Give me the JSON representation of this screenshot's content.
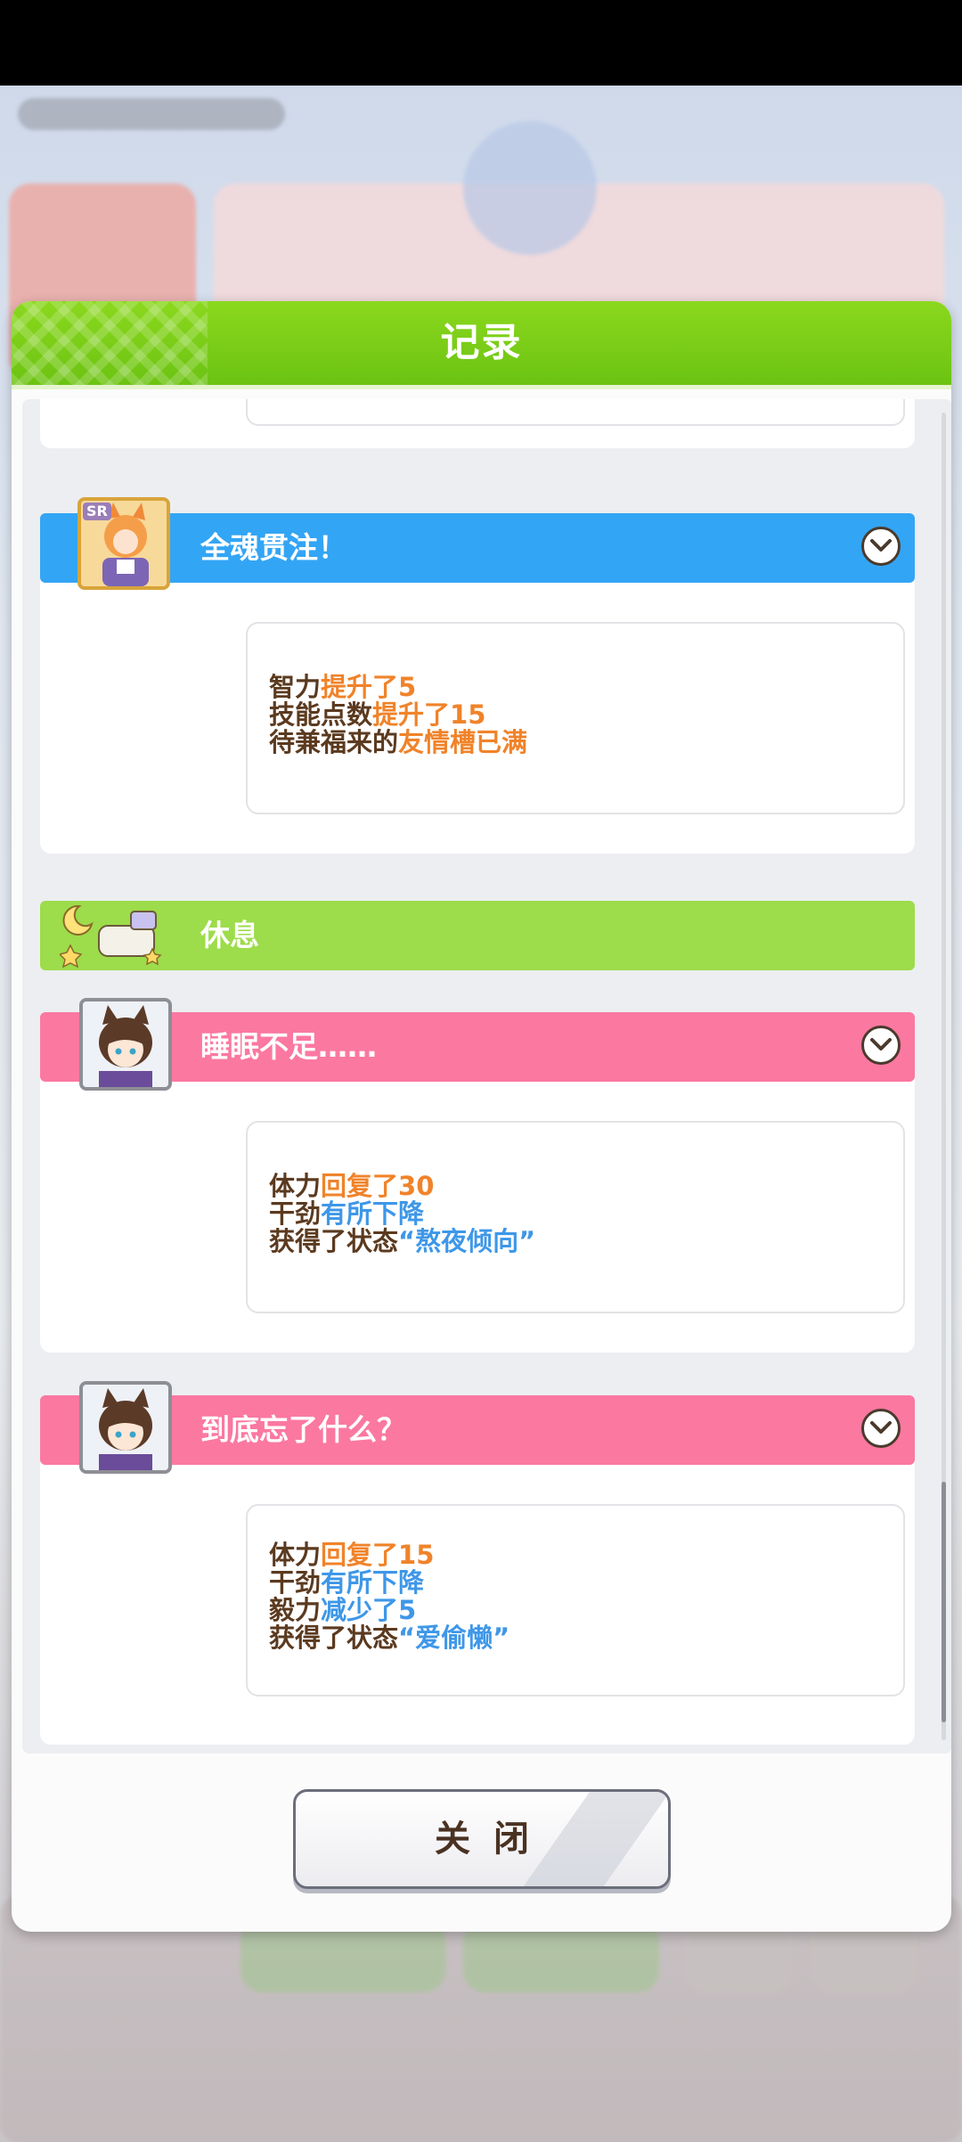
{
  "dialog": {
    "title": "记录"
  },
  "entries": [
    {
      "title": "全魂贯注！",
      "badge": "SR",
      "lines": [
        {
          "plain": "智力",
          "hl": "提升了5",
          "hl_color": "orange"
        },
        {
          "plain": "技能点数",
          "hl": "提升了15",
          "hl_color": "orange"
        },
        {
          "plain": "待兼福来的",
          "hl": "友情槽已满",
          "hl_color": "orange"
        }
      ]
    },
    {
      "title": "休息"
    },
    {
      "title": "睡眠不足……",
      "lines": [
        {
          "plain": "体力",
          "hl": "回复了30",
          "hl_color": "orange"
        },
        {
          "plain": "干劲",
          "hl": "有所下降",
          "hl_color": "blue"
        },
        {
          "plain": "获得了状态",
          "hl": "“熬夜倾向”",
          "hl_color": "blue"
        }
      ]
    },
    {
      "title": "到底忘了什么？",
      "lines": [
        {
          "plain": "体力",
          "hl": "回复了15",
          "hl_color": "orange"
        },
        {
          "plain": "干劲",
          "hl": "有所下降",
          "hl_color": "blue"
        },
        {
          "plain": "毅力",
          "hl": "减少了5",
          "hl_color": "blue"
        },
        {
          "plain": "获得了状态",
          "hl": "“爱偷懒”",
          "hl_color": "blue"
        }
      ]
    }
  ],
  "close_button": {
    "label": "关闭"
  },
  "colors": {
    "header_green": "#6cc312",
    "banner_blue": "#33a5f5",
    "banner_pink": "#fb78a1",
    "banner_green": "#9ddc4a",
    "text_brown": "#5b3a1f",
    "highlight_orange": "#f0832a",
    "highlight_blue": "#3e97e8"
  }
}
